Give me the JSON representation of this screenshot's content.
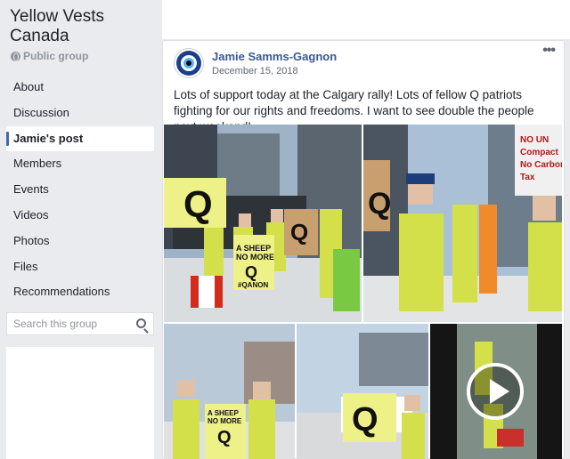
{
  "group": {
    "name": "Yellow Vests Canada",
    "privacy": "Public group",
    "privacy_icon": "globe-icon"
  },
  "sidebar": {
    "items": [
      {
        "label": "About",
        "active": false
      },
      {
        "label": "Discussion",
        "active": false
      },
      {
        "label": "Jamie's post",
        "active": true
      },
      {
        "label": "Members",
        "active": false
      },
      {
        "label": "Events",
        "active": false
      },
      {
        "label": "Videos",
        "active": false
      },
      {
        "label": "Photos",
        "active": false
      },
      {
        "label": "Files",
        "active": false
      },
      {
        "label": "Recommendations",
        "active": false
      }
    ],
    "search_placeholder": "Search this group"
  },
  "post": {
    "author": "Jamie Samms-Gagnon",
    "date": "December 15, 2018",
    "more_label": "•••",
    "text": "Lots of support today at the Calgary rally! Lots of fellow Q patriots fighting for our rights and freedoms. I want to see double the people next weekend!",
    "photos": [
      {
        "kind": "rally-photo",
        "signs": [
          "Q",
          "A SHEEP NO MORE",
          "#QANON",
          "Q"
        ]
      },
      {
        "kind": "rally-photo",
        "signs": [
          "Q",
          "NO UN Compact No Carbon Tax"
        ]
      },
      {
        "kind": "rally-photo",
        "signs": [
          "A SHEEP NO MORE",
          "Q"
        ]
      },
      {
        "kind": "rally-photo",
        "signs": [
          "Q"
        ]
      },
      {
        "kind": "video",
        "icon": "play-icon"
      }
    ]
  },
  "colors": {
    "link": "#385898",
    "accent": "#4267b2",
    "page_bg": "#e9ebee",
    "muted": "#90949c"
  }
}
